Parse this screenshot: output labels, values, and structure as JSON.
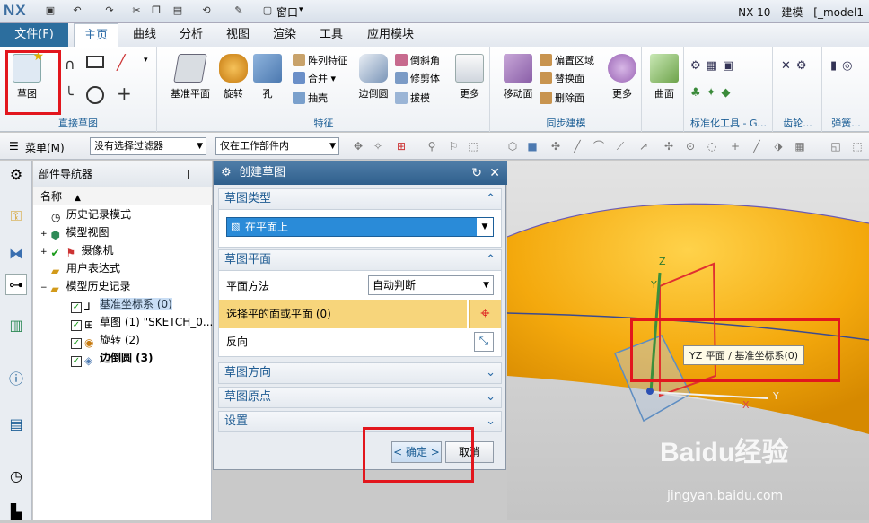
{
  "titlebar": {
    "logo": "NX",
    "window_menu": "窗口",
    "title": "NX 10 - 建模 - [_model1"
  },
  "tabs": {
    "file": "文件(F)",
    "items": [
      "主页",
      "曲线",
      "分析",
      "视图",
      "渲染",
      "工具",
      "应用模块"
    ],
    "active": "主页"
  },
  "ribbon": {
    "direct_sketch": {
      "label": "直接草图",
      "sketch_button": "草图"
    },
    "feature": {
      "label": "特征",
      "datum_plane": "基准平面",
      "revolve": "旋转",
      "hole": "孔",
      "pattern_feature": "阵列特征",
      "unite": "合并",
      "shell": "抽壳",
      "edge_blend": "边倒圆",
      "chamfer": "倒斜角",
      "trim_body": "修剪体",
      "draft": "拔模",
      "more": "更多"
    },
    "sync": {
      "label": "同步建模",
      "move_face": "移动面",
      "offset_region": "偏置区域",
      "replace_face": "替换面",
      "delete_face": "删除面",
      "more": "更多"
    },
    "surface": {
      "surface": "曲面"
    },
    "standard": {
      "label": "标准化工具 - G..."
    },
    "gear": {
      "label": "齿轮..."
    },
    "spring": {
      "label": "弹簧..."
    }
  },
  "toolbar2": {
    "menu": "菜单(M)",
    "filter": "没有选择过滤器",
    "scope": "仅在工作部件内"
  },
  "navigator": {
    "title": "部件导航器",
    "column": "名称",
    "items": [
      {
        "label": "历史记录模式"
      },
      {
        "label": "模型视图"
      },
      {
        "label": "摄像机"
      },
      {
        "label": "用户表达式"
      },
      {
        "label": "模型历史记录"
      },
      {
        "label": "基准坐标系 (0)"
      },
      {
        "label": "草图 (1) \"SKETCH_0..."
      },
      {
        "label": "旋转 (2)"
      },
      {
        "label": "边倒圆 (3)"
      }
    ]
  },
  "dialog": {
    "title": "创建草图",
    "sketch_type": {
      "header": "草图类型",
      "value": "在平面上"
    },
    "sketch_plane": {
      "header": "草图平面",
      "method_label": "平面方法",
      "method_value": "自动判断",
      "select_label": "选择平的面或平面 (0)",
      "reverse_label": "反向"
    },
    "orientation": "草图方向",
    "origin": "草图原点",
    "settings": "设置",
    "ok": "< 确定 >",
    "cancel": "取消"
  },
  "viewport": {
    "tooltip": "YZ 平面 / 基准坐标系(0)",
    "axis_z": "Z",
    "axis_y": "Y",
    "axis_x": "X",
    "axis_y2": "Y"
  },
  "watermark": {
    "brand": "Baidu经验",
    "url": "jingyan.baidu.com"
  },
  "colors": {
    "accent": "#2c6e9e",
    "highlight": "#f7d57b",
    "annotation": "#e2161d",
    "part": "#f4a90d"
  }
}
